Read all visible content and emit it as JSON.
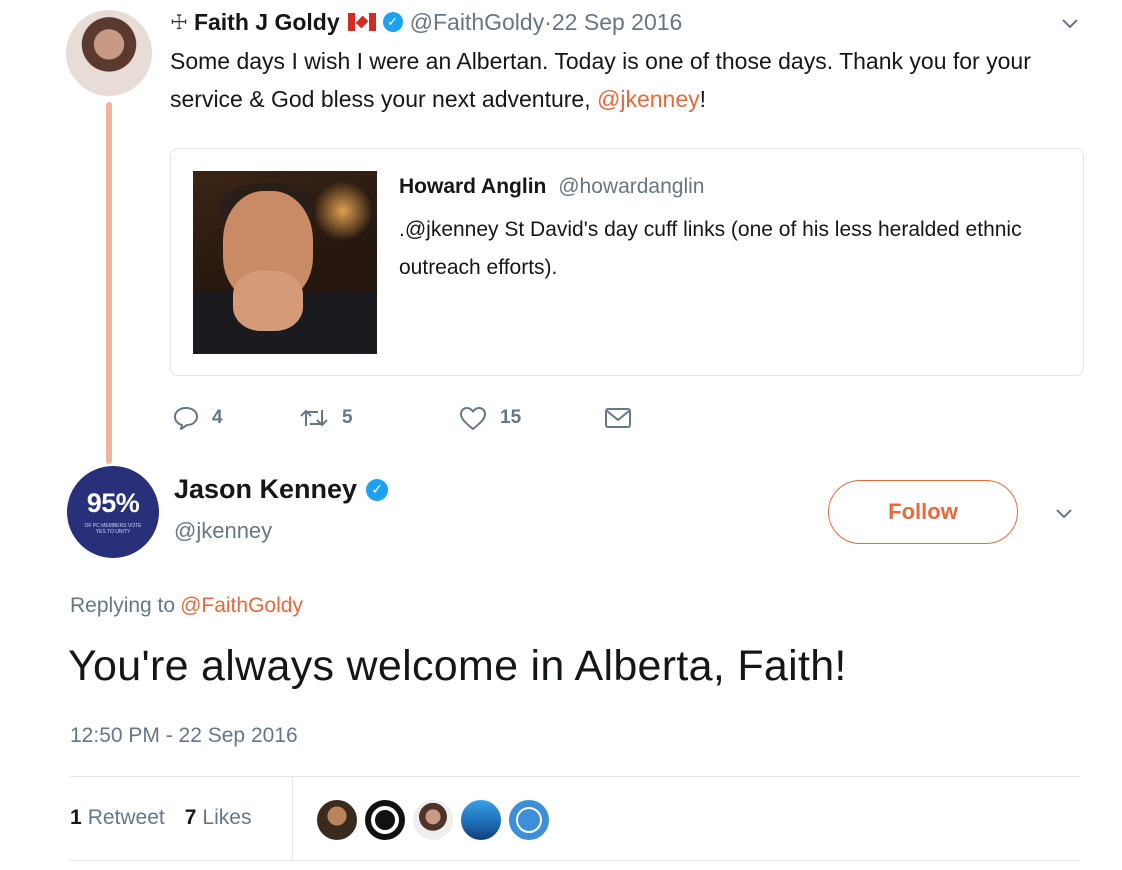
{
  "parent_tweet": {
    "cross_glyph": "☩",
    "author_name": "Faith J Goldy",
    "handle": "@FaithGoldy",
    "separator": " · ",
    "date": "22 Sep 2016",
    "text_before_mention": "Some days I wish I were an Albertan. Today is one of those days. Thank you for your service & God bless your next adventure, ",
    "mention": "@jkenney",
    "text_after_mention": "!",
    "quoted": {
      "author_name": "Howard Anglin",
      "handle": "@howardanglin",
      "text": ".@jkenney St David's day cuff links (one of his less heralded ethnic outreach efforts)."
    },
    "actions": {
      "reply_count": "4",
      "retweet_count": "5",
      "like_count": "15"
    }
  },
  "main_tweet": {
    "avatar_text": "95%",
    "avatar_subtext": "OF PC MEMBERS VOTE YES TO UNITY",
    "author_name": "Jason Kenney",
    "handle": "@jkenney",
    "follow_label": "Follow",
    "replying_label": "Replying to",
    "replying_handle": "@FaithGoldy",
    "text": "You're always welcome in Alberta, Faith!",
    "timestamp": "12:50 PM - 22 Sep 2016",
    "retweet_count": "1",
    "retweet_label": "Retweet",
    "like_count": "7",
    "like_label": "Likes"
  },
  "colors": {
    "accent": "#e8693c",
    "verified": "#1da1f2",
    "muted": "#657786",
    "thread_line": "#f4b39a"
  }
}
